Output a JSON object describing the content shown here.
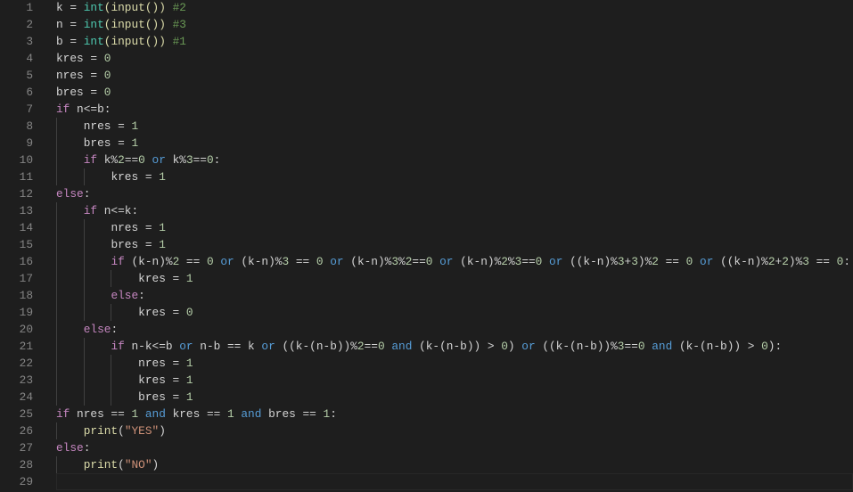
{
  "editor": {
    "language": "python",
    "current_line": 29,
    "lines": [
      {
        "n": "1",
        "indent": 0,
        "tokens": [
          {
            "t": "tx",
            "s": "k = "
          },
          {
            "t": "cls",
            "s": "int"
          },
          {
            "t": "fn",
            "s": "(input())"
          },
          {
            "t": "tx",
            "s": " "
          },
          {
            "t": "cm",
            "s": "#2"
          }
        ]
      },
      {
        "n": "2",
        "indent": 0,
        "tokens": [
          {
            "t": "tx",
            "s": "n = "
          },
          {
            "t": "cls",
            "s": "int"
          },
          {
            "t": "fn",
            "s": "(input())"
          },
          {
            "t": "tx",
            "s": " "
          },
          {
            "t": "cm",
            "s": "#3"
          }
        ]
      },
      {
        "n": "3",
        "indent": 0,
        "tokens": [
          {
            "t": "tx",
            "s": "b = "
          },
          {
            "t": "cls",
            "s": "int"
          },
          {
            "t": "fn",
            "s": "(input())"
          },
          {
            "t": "tx",
            "s": " "
          },
          {
            "t": "cm",
            "s": "#1"
          }
        ]
      },
      {
        "n": "4",
        "indent": 0,
        "tokens": [
          {
            "t": "tx",
            "s": "kres = "
          },
          {
            "t": "num",
            "s": "0"
          }
        ]
      },
      {
        "n": "5",
        "indent": 0,
        "tokens": [
          {
            "t": "tx",
            "s": "nres = "
          },
          {
            "t": "num",
            "s": "0"
          }
        ]
      },
      {
        "n": "6",
        "indent": 0,
        "tokens": [
          {
            "t": "tx",
            "s": "bres = "
          },
          {
            "t": "num",
            "s": "0"
          }
        ]
      },
      {
        "n": "7",
        "indent": 0,
        "tokens": [
          {
            "t": "kw",
            "s": "if"
          },
          {
            "t": "tx",
            "s": " n<=b:"
          }
        ]
      },
      {
        "n": "8",
        "indent": 1,
        "tokens": [
          {
            "t": "tx",
            "s": "nres = "
          },
          {
            "t": "num",
            "s": "1"
          }
        ]
      },
      {
        "n": "9",
        "indent": 1,
        "tokens": [
          {
            "t": "tx",
            "s": "bres = "
          },
          {
            "t": "num",
            "s": "1"
          }
        ]
      },
      {
        "n": "10",
        "indent": 1,
        "tokens": [
          {
            "t": "kw",
            "s": "if"
          },
          {
            "t": "tx",
            "s": " k%"
          },
          {
            "t": "num",
            "s": "2"
          },
          {
            "t": "tx",
            "s": "=="
          },
          {
            "t": "num",
            "s": "0"
          },
          {
            "t": "op",
            "s": " or "
          },
          {
            "t": "tx",
            "s": "k%"
          },
          {
            "t": "num",
            "s": "3"
          },
          {
            "t": "tx",
            "s": "=="
          },
          {
            "t": "num",
            "s": "0"
          },
          {
            "t": "tx",
            "s": ":"
          }
        ]
      },
      {
        "n": "11",
        "indent": 2,
        "tokens": [
          {
            "t": "tx",
            "s": "kres = "
          },
          {
            "t": "num",
            "s": "1"
          }
        ]
      },
      {
        "n": "12",
        "indent": 0,
        "tokens": [
          {
            "t": "kw",
            "s": "else"
          },
          {
            "t": "tx",
            "s": ":"
          }
        ]
      },
      {
        "n": "13",
        "indent": 1,
        "tokens": [
          {
            "t": "kw",
            "s": "if"
          },
          {
            "t": "tx",
            "s": " n<=k:"
          }
        ]
      },
      {
        "n": "14",
        "indent": 2,
        "tokens": [
          {
            "t": "tx",
            "s": "nres = "
          },
          {
            "t": "num",
            "s": "1"
          }
        ]
      },
      {
        "n": "15",
        "indent": 2,
        "tokens": [
          {
            "t": "tx",
            "s": "bres = "
          },
          {
            "t": "num",
            "s": "1"
          }
        ]
      },
      {
        "n": "16",
        "indent": 2,
        "tokens": [
          {
            "t": "kw",
            "s": "if"
          },
          {
            "t": "tx",
            "s": " (k-n)%"
          },
          {
            "t": "num",
            "s": "2"
          },
          {
            "t": "tx",
            "s": " == "
          },
          {
            "t": "num",
            "s": "0"
          },
          {
            "t": "op",
            "s": " or "
          },
          {
            "t": "tx",
            "s": "(k-n)%"
          },
          {
            "t": "num",
            "s": "3"
          },
          {
            "t": "tx",
            "s": " == "
          },
          {
            "t": "num",
            "s": "0"
          },
          {
            "t": "op",
            "s": " or "
          },
          {
            "t": "tx",
            "s": "(k-n)%"
          },
          {
            "t": "num",
            "s": "3"
          },
          {
            "t": "tx",
            "s": "%"
          },
          {
            "t": "num",
            "s": "2"
          },
          {
            "t": "tx",
            "s": "=="
          },
          {
            "t": "num",
            "s": "0"
          },
          {
            "t": "op",
            "s": " or "
          },
          {
            "t": "tx",
            "s": "(k-n)%"
          },
          {
            "t": "num",
            "s": "2"
          },
          {
            "t": "tx",
            "s": "%"
          },
          {
            "t": "num",
            "s": "3"
          },
          {
            "t": "tx",
            "s": "=="
          },
          {
            "t": "num",
            "s": "0"
          },
          {
            "t": "op",
            "s": " or "
          },
          {
            "t": "tx",
            "s": "((k-n)%"
          },
          {
            "t": "num",
            "s": "3"
          },
          {
            "t": "tx",
            "s": "+"
          },
          {
            "t": "num",
            "s": "3"
          },
          {
            "t": "tx",
            "s": ")%"
          },
          {
            "t": "num",
            "s": "2"
          },
          {
            "t": "tx",
            "s": " == "
          },
          {
            "t": "num",
            "s": "0"
          },
          {
            "t": "op",
            "s": " or "
          },
          {
            "t": "tx",
            "s": "((k-n)%"
          },
          {
            "t": "num",
            "s": "2"
          },
          {
            "t": "tx",
            "s": "+"
          },
          {
            "t": "num",
            "s": "2"
          },
          {
            "t": "tx",
            "s": ")%"
          },
          {
            "t": "num",
            "s": "3"
          },
          {
            "t": "tx",
            "s": " == "
          },
          {
            "t": "num",
            "s": "0"
          },
          {
            "t": "tx",
            "s": ":"
          }
        ]
      },
      {
        "n": "17",
        "indent": 3,
        "tokens": [
          {
            "t": "tx",
            "s": "kres = "
          },
          {
            "t": "num",
            "s": "1"
          }
        ]
      },
      {
        "n": "18",
        "indent": 2,
        "tokens": [
          {
            "t": "kw",
            "s": "else"
          },
          {
            "t": "tx",
            "s": ":"
          }
        ]
      },
      {
        "n": "19",
        "indent": 3,
        "tokens": [
          {
            "t": "tx",
            "s": "kres = "
          },
          {
            "t": "num",
            "s": "0"
          }
        ]
      },
      {
        "n": "20",
        "indent": 1,
        "tokens": [
          {
            "t": "kw",
            "s": "else"
          },
          {
            "t": "tx",
            "s": ":"
          }
        ]
      },
      {
        "n": "21",
        "indent": 2,
        "tokens": [
          {
            "t": "kw",
            "s": "if"
          },
          {
            "t": "tx",
            "s": " n-k<=b"
          },
          {
            "t": "op",
            "s": " or "
          },
          {
            "t": "tx",
            "s": "n-b == k"
          },
          {
            "t": "op",
            "s": " or "
          },
          {
            "t": "tx",
            "s": "((k-(n-b))%"
          },
          {
            "t": "num",
            "s": "2"
          },
          {
            "t": "tx",
            "s": "=="
          },
          {
            "t": "num",
            "s": "0"
          },
          {
            "t": "op",
            "s": " and "
          },
          {
            "t": "tx",
            "s": "(k-(n-b)) > "
          },
          {
            "t": "num",
            "s": "0"
          },
          {
            "t": "tx",
            "s": ")"
          },
          {
            "t": "op",
            "s": " or "
          },
          {
            "t": "tx",
            "s": "((k-(n-b))%"
          },
          {
            "t": "num",
            "s": "3"
          },
          {
            "t": "tx",
            "s": "=="
          },
          {
            "t": "num",
            "s": "0"
          },
          {
            "t": "op",
            "s": " and "
          },
          {
            "t": "tx",
            "s": "(k-(n-b)) > "
          },
          {
            "t": "num",
            "s": "0"
          },
          {
            "t": "tx",
            "s": "):"
          }
        ]
      },
      {
        "n": "22",
        "indent": 3,
        "tokens": [
          {
            "t": "tx",
            "s": "nres = "
          },
          {
            "t": "num",
            "s": "1"
          }
        ]
      },
      {
        "n": "23",
        "indent": 3,
        "tokens": [
          {
            "t": "tx",
            "s": "kres = "
          },
          {
            "t": "num",
            "s": "1"
          }
        ]
      },
      {
        "n": "24",
        "indent": 3,
        "tokens": [
          {
            "t": "tx",
            "s": "bres = "
          },
          {
            "t": "num",
            "s": "1"
          }
        ]
      },
      {
        "n": "25",
        "indent": 0,
        "tokens": [
          {
            "t": "kw",
            "s": "if"
          },
          {
            "t": "tx",
            "s": " nres == "
          },
          {
            "t": "num",
            "s": "1"
          },
          {
            "t": "op",
            "s": " and "
          },
          {
            "t": "tx",
            "s": "kres == "
          },
          {
            "t": "num",
            "s": "1"
          },
          {
            "t": "op",
            "s": " and "
          },
          {
            "t": "tx",
            "s": "bres == "
          },
          {
            "t": "num",
            "s": "1"
          },
          {
            "t": "tx",
            "s": ":"
          }
        ]
      },
      {
        "n": "26",
        "indent": 1,
        "tokens": [
          {
            "t": "fn",
            "s": "print"
          },
          {
            "t": "tx",
            "s": "("
          },
          {
            "t": "str",
            "s": "\"YES\""
          },
          {
            "t": "tx",
            "s": ")"
          }
        ]
      },
      {
        "n": "27",
        "indent": 0,
        "tokens": [
          {
            "t": "kw",
            "s": "else"
          },
          {
            "t": "tx",
            "s": ":"
          }
        ]
      },
      {
        "n": "28",
        "indent": 1,
        "tokens": [
          {
            "t": "fn",
            "s": "print"
          },
          {
            "t": "tx",
            "s": "("
          },
          {
            "t": "str",
            "s": "\"NO\""
          },
          {
            "t": "tx",
            "s": ")"
          }
        ]
      },
      {
        "n": "29",
        "indent": 0,
        "tokens": []
      }
    ]
  },
  "colors": {
    "background": "#1e1e1e",
    "keyword": "#c586c0",
    "operator": "#569cd6",
    "function": "#dcdcaa",
    "class": "#4ec9b0",
    "number": "#b5cea8",
    "comment": "#6a9955",
    "string": "#ce9178"
  }
}
